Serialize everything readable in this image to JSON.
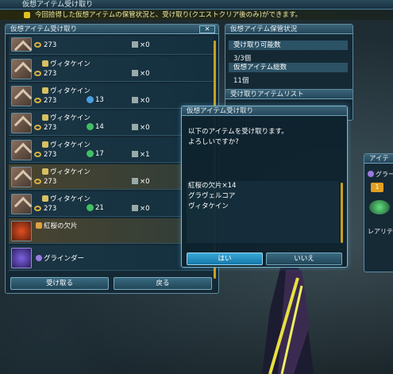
{
  "window_title": "仮想アイテム受け取り",
  "notice": "今回拾得した仮想アイテムの保管状況と、受け取り(クエストクリア後のみ)ができます。",
  "list_panel": {
    "title": "仮想アイテム受け取り",
    "close_label": "✕",
    "items": [
      {
        "name": "",
        "level": "273",
        "element": "",
        "count": "×0",
        "icon": "sword-icon",
        "highlight": false
      },
      {
        "name": "ヴィタケイン",
        "level": "273",
        "element": "",
        "count": "×0",
        "icon": "sword-icon",
        "highlight": false
      },
      {
        "name": "ヴィタケイン",
        "level": "273",
        "element": "13",
        "count": "×0",
        "icon": "sword-icon",
        "highlight": false
      },
      {
        "name": "ヴィタケイン",
        "level": "273",
        "element": "14",
        "count": "×0",
        "icon": "sword-icon",
        "highlight": false
      },
      {
        "name": "ヴィタケイン",
        "level": "273",
        "element": "17",
        "count": "×1",
        "icon": "sword-icon",
        "highlight": false
      },
      {
        "name": "ヴィタケイン",
        "level": "273",
        "element": "",
        "count": "×0",
        "icon": "sword-icon",
        "highlight": true
      },
      {
        "name": "ヴィタケイン",
        "level": "273",
        "element": "21",
        "count": "×0",
        "icon": "sword-icon",
        "highlight": false
      },
      {
        "name": "紅桜の欠片",
        "level": "",
        "element": "",
        "count": "",
        "icon": "crystal-icon",
        "highlight": true
      },
      {
        "name": "グラインダー",
        "level": "",
        "element": "",
        "count": "",
        "icon": "grinder-icon",
        "highlight": false
      }
    ],
    "receive_label": "受け取る",
    "back_label": "戻る"
  },
  "status_panel": {
    "title": "仮想アイテム保管状況",
    "receivable_label": "受け取り可能数",
    "receivable_value": "3/3個",
    "total_label": "仮想アイテム総数",
    "total_value": "11個"
  },
  "receive_list_panel": {
    "title": "受け取りアイテムリスト"
  },
  "confirm_dialog": {
    "title": "仮想アイテム受け取り",
    "message_line1": "以下のアイテムを受け取ります。",
    "message_line2": "よろしいですか?",
    "items": [
      "紅桜の欠片×14",
      "グラヴェルコア",
      "ヴィタケイン"
    ],
    "yes_label": "はい",
    "no_label": "いいえ"
  },
  "side_panel": {
    "title": "アイテ",
    "subtitle": "グラー",
    "badge": "1",
    "rarity_label": "レアリティ"
  },
  "colors": {
    "accent": "#3aa8d8",
    "panel_bg": "#14303e",
    "highlight": "#c8a020"
  }
}
